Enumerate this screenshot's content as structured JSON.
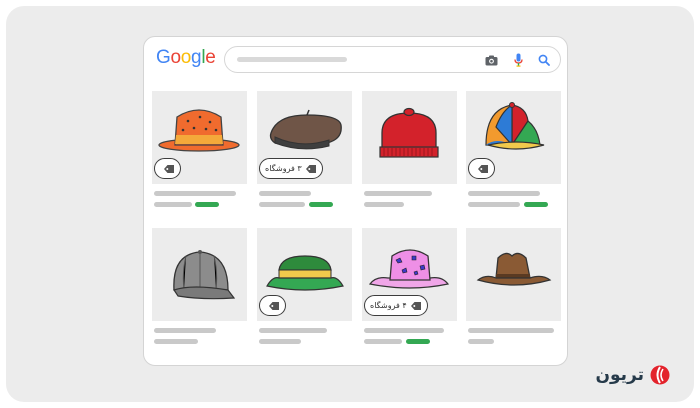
{
  "logo": {
    "letters": [
      {
        "char": "G",
        "color": "#4285f4"
      },
      {
        "char": "o",
        "color": "#ea4335"
      },
      {
        "char": "o",
        "color": "#fbbc05"
      },
      {
        "char": "g",
        "color": "#4285f4"
      },
      {
        "char": "l",
        "color": "#34a853"
      },
      {
        "char": "e",
        "color": "#ea4335"
      }
    ]
  },
  "search": {
    "icons": [
      "camera-icon",
      "microphone-icon",
      "search-icon"
    ]
  },
  "products": [
    {
      "hat": "orange-bucket-hat",
      "badge": true,
      "badge_label": "",
      "price_bar": true
    },
    {
      "hat": "brown-beret",
      "badge": true,
      "badge_label": "۳ فروشگاه",
      "price_bar": true
    },
    {
      "hat": "red-beanie",
      "badge": false,
      "badge_label": "",
      "price_bar": false
    },
    {
      "hat": "multicolor-cap",
      "badge": true,
      "badge_label": "",
      "price_bar": true
    },
    {
      "hat": "gray-baseball-cap",
      "badge": false,
      "badge_label": "",
      "price_bar": false
    },
    {
      "hat": "green-bucket-hat",
      "badge": true,
      "badge_label": "",
      "price_bar": false
    },
    {
      "hat": "pink-patterned-hat",
      "badge": true,
      "badge_label": "۴ فروشگاه",
      "price_bar": true
    },
    {
      "hat": "brown-cowboy-hat",
      "badge": false,
      "badge_label": "",
      "price_bar": false
    }
  ],
  "brand": {
    "name": "تریون",
    "color": "#263a4a",
    "accent": "#e3232c"
  },
  "colors": {
    "green": "#34a853",
    "placeholder": "#c9c9c9"
  }
}
